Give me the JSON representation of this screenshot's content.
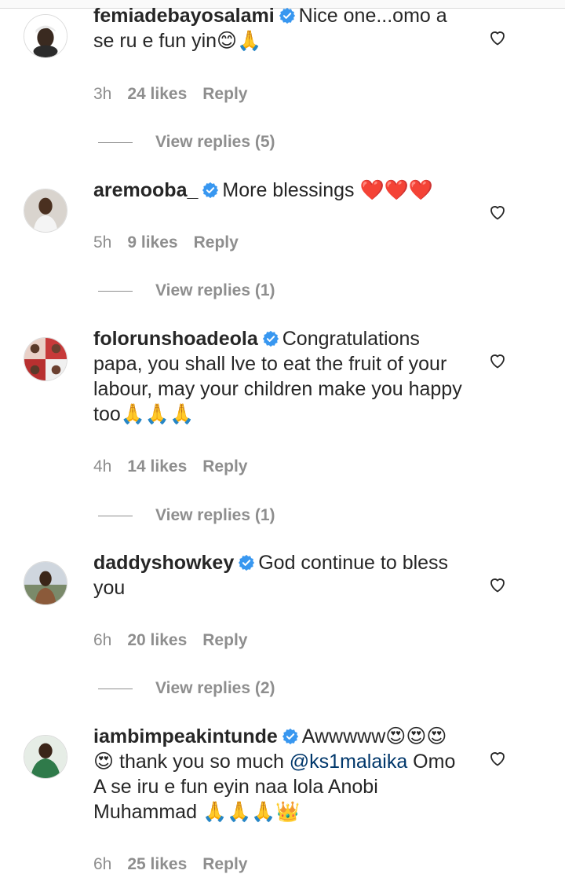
{
  "comments": [
    {
      "username": "femiadebayosalami",
      "text": "Nice one...omo a se ru e fun yin😊🙏",
      "time": "3h",
      "likes": "24 likes",
      "reply": "Reply",
      "view_replies": "View replies (5)"
    },
    {
      "username": "aremooba_",
      "text": "More blessings ❤️❤️❤️",
      "time": "5h",
      "likes": "9 likes",
      "reply": "Reply",
      "view_replies": "View replies (1)"
    },
    {
      "username": "folorunshoadeola",
      "text": "Congratulations papa, you shall lve to eat the fruit of your labour, may your children make you happy too🙏🙏🙏",
      "time": "4h",
      "likes": "14 likes",
      "reply": "Reply",
      "view_replies": "View replies (1)"
    },
    {
      "username": "daddyshowkey",
      "text": "God continue to bless you",
      "time": "6h",
      "likes": "20 likes",
      "reply": "Reply",
      "view_replies": "View replies (2)"
    },
    {
      "username": "iambimpeakintunde",
      "text_before": "Awwwww😍😍😍😍 thank you so much ",
      "mention": "@ks1malaika",
      "text_after": " Omo A se iru e fun eyin naa lola Anobi Muhammad 🙏🙏🙏👑",
      "time": "6h",
      "likes": "25 likes",
      "reply": "Reply"
    }
  ],
  "colors": {
    "primary_text": "#262626",
    "secondary_text": "#8e8e8e",
    "verified_badge": "#3897f0",
    "mention_link": "#00376b"
  },
  "icons": {
    "verified": "verified-badge-icon",
    "like": "heart-outline-icon"
  }
}
